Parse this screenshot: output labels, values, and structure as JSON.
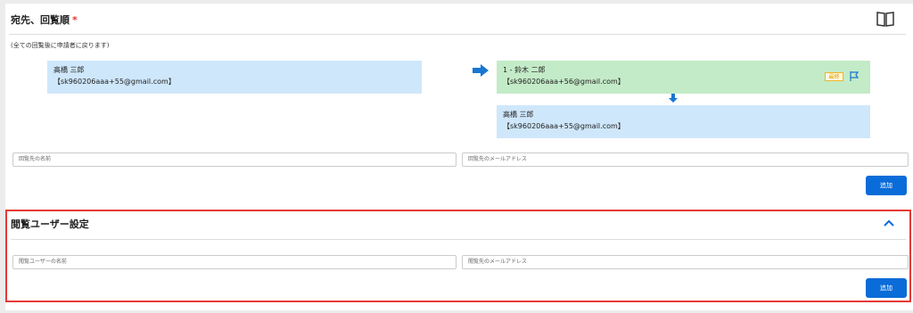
{
  "header": {
    "title": "宛先、回覧順",
    "required_mark": "*",
    "hint": "(全ての回覧後に申請者に戻ります)"
  },
  "applicant": {
    "name": "高橋 三郎",
    "email": "【sk960206aaa+55@gmail.com】"
  },
  "route": [
    {
      "name": "1 - 鈴木 二郎",
      "email": "【sk960206aaa+56@gmail.com】",
      "badge": "最終",
      "color": "#c3ebc7"
    },
    {
      "name": "高橋 三郎",
      "email": "【sk960206aaa+55@gmail.com】",
      "color": "#cfe7fb"
    }
  ],
  "recipient_form": {
    "name_placeholder": "回覧先の名前",
    "email_placeholder": "回覧先のメールアドレス",
    "add_label": "追加"
  },
  "viewer_section": {
    "title": "閲覧ユーザー設定",
    "name_placeholder": "閲覧ユーザーの名前",
    "email_placeholder": "閲覧先のメールアドレス",
    "add_label": "追加"
  },
  "colors": {
    "accent": "#0a6cd8",
    "highlight": "#e53935"
  }
}
